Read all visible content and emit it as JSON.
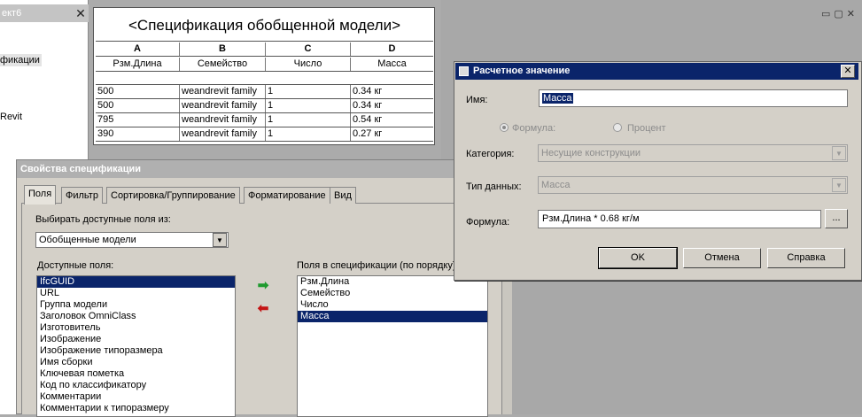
{
  "project_browser": {
    "title": "ект6",
    "close": "✕",
    "item1": "фикации",
    "item2": "Revit"
  },
  "editor": {
    "controls": "▭▢✕"
  },
  "schedule": {
    "title": "<Спецификация обобщенной модели>",
    "column_letters": [
      "A",
      "B",
      "C",
      "D"
    ],
    "column_headers": [
      "Рзм.Длина",
      "Семейство",
      "Число",
      "Масса"
    ],
    "rows": [
      [
        "500",
        "weandrevit family",
        "1",
        "0.34 кг"
      ],
      [
        "500",
        "weandrevit family",
        "1",
        "0.34 кг"
      ],
      [
        "795",
        "weandrevit family",
        "1",
        "0.54 кг"
      ],
      [
        "390",
        "weandrevit family",
        "1",
        "0.27 кг"
      ]
    ]
  },
  "properties_dialog": {
    "title": "Свойства спецификации",
    "tabs": [
      "Поля",
      "Фильтр",
      "Сортировка/Группирование",
      "Форматирование",
      "Вид"
    ],
    "choose_fields_label": "Выбирать доступные поля из:",
    "choose_fields_value": "Обобщенные модели",
    "available_label": "Доступные поля:",
    "scheduled_label": "Поля в спецификации (по порядку):",
    "available_fields": [
      "IfcGUID",
      "URL",
      "Группа модели",
      "Заголовок OmniClass",
      "Изготовитель",
      "Изображение",
      "Изображение типоразмера",
      "Имя сборки",
      "Ключевая пометка",
      "Код по классификатору",
      "Комментарии",
      "Комментарии к типоразмеру"
    ],
    "available_selected": "IfcGUID",
    "scheduled_fields": [
      "Рзм.Длина",
      "Семейство",
      "Число",
      "Масса"
    ],
    "scheduled_selected": "Масса",
    "add_arrow": "➡",
    "remove_arrow": "⬅"
  },
  "calc_dialog": {
    "title": "Расчетное значение",
    "close": "✕",
    "name_label": "Имя:",
    "name_value": "Масса",
    "radio_formula": "Формула:",
    "radio_percent": "Процент",
    "category_label": "Категория:",
    "category_value": "Несущие конструкции",
    "datatype_label": "Тип данных:",
    "datatype_value": "Масса",
    "formula_label": "Формула:",
    "formula_value": "Рзм.Длина * 0.68 кг/м",
    "dots_label": "...",
    "ok_label": "OK",
    "cancel_label": "Отмена",
    "help_label": "Справка"
  }
}
